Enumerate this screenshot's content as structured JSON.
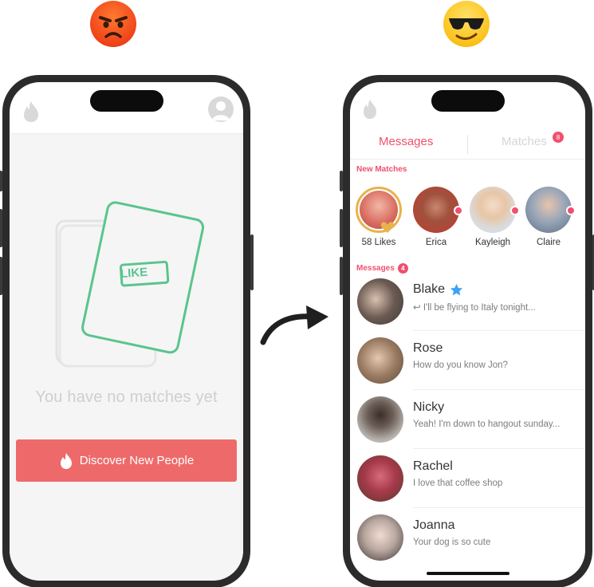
{
  "colors": {
    "accent": "#f0506e",
    "discover_button": "#ee6a6a",
    "like_card": "#5ac48e",
    "likes_ring": "#e8b34a",
    "star": "#3ba2f5"
  },
  "top_emojis": [
    {
      "icon": "angry-face-emoji"
    },
    {
      "icon": "sunglasses-face-emoji"
    }
  ],
  "left_screen": {
    "card_label": "LIKE",
    "empty_text": "You have no matches yet",
    "discover_button": {
      "label": "Discover New People",
      "icon": "flame-icon"
    }
  },
  "right_screen": {
    "tabs": [
      {
        "label": "Messages",
        "active": true
      },
      {
        "label": "Matches",
        "badge": "8",
        "active": false
      }
    ],
    "new_matches": {
      "label": "New Matches",
      "items": [
        {
          "name": "58 Likes",
          "type": "likes"
        },
        {
          "name": "Erica"
        },
        {
          "name": "Kayleigh"
        },
        {
          "name": "Claire"
        }
      ]
    },
    "messages": {
      "label": "Messages",
      "badge": "4",
      "items": [
        {
          "name": "Blake",
          "preview": "↩ I'll be flying to Italy tonight...",
          "starred": true
        },
        {
          "name": "Rose",
          "preview": "How do you know Jon?"
        },
        {
          "name": "Nicky",
          "preview": "Yeah! I'm down to hangout sunday..."
        },
        {
          "name": "Rachel",
          "preview": "I love that coffee shop"
        },
        {
          "name": "Joanna",
          "preview": "Your dog is so cute"
        }
      ]
    }
  }
}
